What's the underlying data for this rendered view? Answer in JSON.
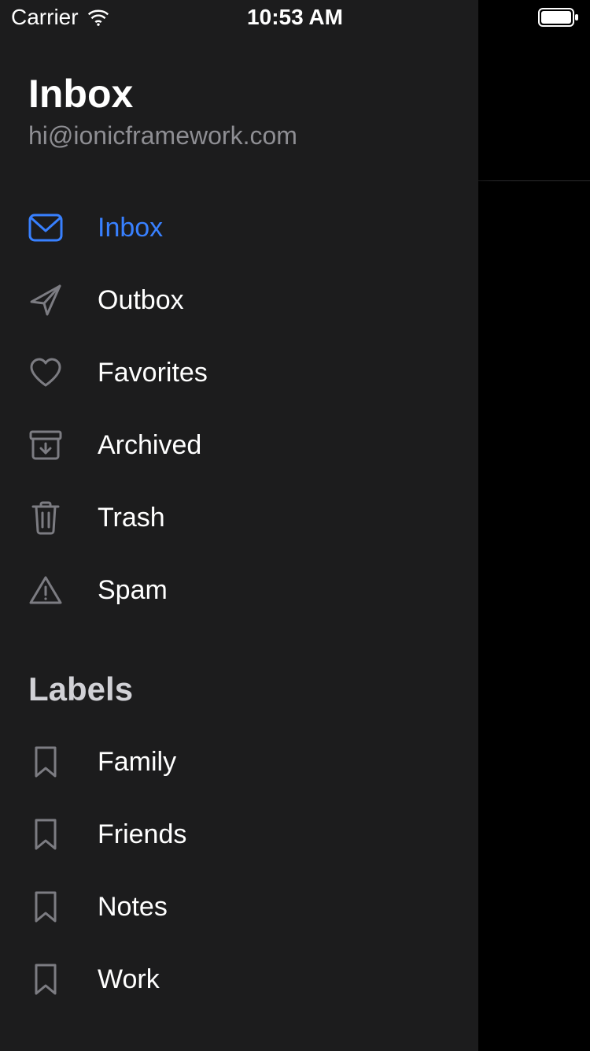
{
  "status_bar": {
    "carrier": "Carrier",
    "time": "10:53 AM"
  },
  "menu": {
    "title": "Inbox",
    "subtitle": "hi@ionicframework.com",
    "items": [
      {
        "label": "Inbox",
        "icon": "mail-icon",
        "selected": true
      },
      {
        "label": "Outbox",
        "icon": "paper-plane-icon",
        "selected": false
      },
      {
        "label": "Favorites",
        "icon": "heart-icon",
        "selected": false
      },
      {
        "label": "Archived",
        "icon": "archive-icon",
        "selected": false
      },
      {
        "label": "Trash",
        "icon": "trash-icon",
        "selected": false
      },
      {
        "label": "Spam",
        "icon": "warning-icon",
        "selected": false
      }
    ],
    "labels_header": "Labels",
    "labels": [
      {
        "label": "Family",
        "icon": "bookmark-icon"
      },
      {
        "label": "Friends",
        "icon": "bookmark-icon"
      },
      {
        "label": "Notes",
        "icon": "bookmark-icon"
      },
      {
        "label": "Work",
        "icon": "bookmark-icon"
      }
    ]
  },
  "colors": {
    "accent": "#3880ff",
    "panel_bg": "#1c1c1d",
    "icon_muted": "#7c7c82",
    "text_muted": "#8e8e93"
  }
}
